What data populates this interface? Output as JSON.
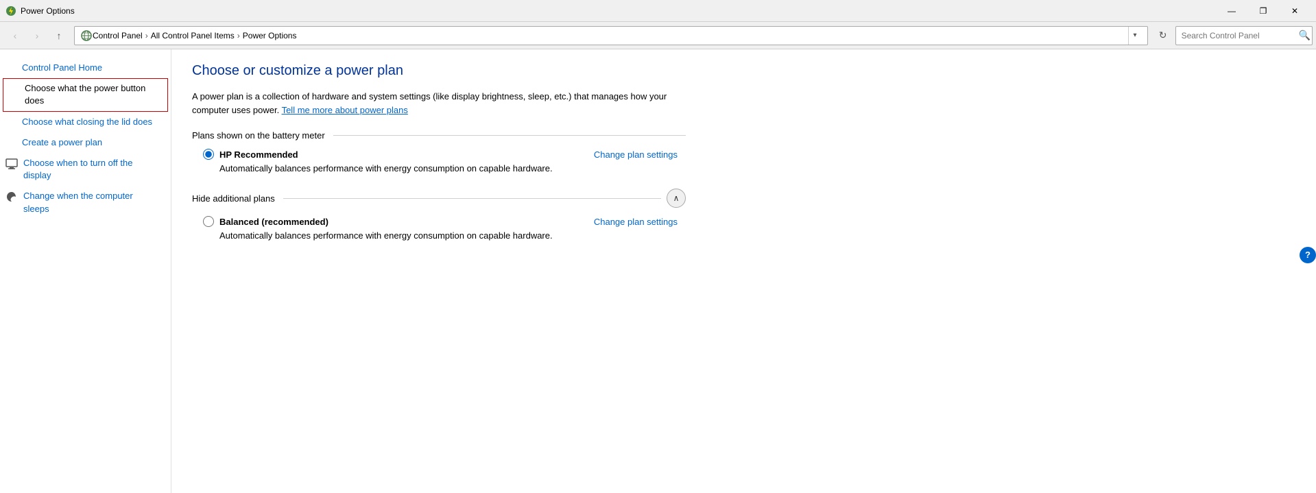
{
  "titleBar": {
    "title": "Power Options",
    "iconColor": "#4a8a4a",
    "controls": {
      "minimize": "—",
      "maximize": "❐",
      "close": "✕"
    }
  },
  "navBar": {
    "back": "‹",
    "forward": "›",
    "up": "↑",
    "refresh": "↻",
    "breadcrumb": [
      {
        "label": "Control Panel",
        "sep": "›"
      },
      {
        "label": "All Control Panel Items",
        "sep": "›"
      },
      {
        "label": "Power Options",
        "sep": ""
      }
    ],
    "searchPlaceholder": ""
  },
  "sidebar": {
    "items": [
      {
        "id": "control-panel-home",
        "label": "Control Panel Home",
        "icon": null,
        "active": false
      },
      {
        "id": "power-button",
        "label": "Choose what the power button does",
        "icon": null,
        "active": true
      },
      {
        "id": "lid",
        "label": "Choose what closing the lid does",
        "icon": null,
        "active": false
      },
      {
        "id": "create-plan",
        "label": "Create a power plan",
        "icon": null,
        "active": false
      },
      {
        "id": "turn-off-display",
        "label": "Choose when to turn off the display",
        "icon": "display",
        "active": false
      },
      {
        "id": "computer-sleeps",
        "label": "Change when the computer sleeps",
        "icon": "sleep",
        "active": false
      }
    ]
  },
  "content": {
    "pageTitle": "Choose or customize a power plan",
    "description1": "A power plan is a collection of hardware and system settings (like display brightness, sleep, etc.) that manages how your computer uses power.",
    "learnMoreText": "Tell me more about power plans",
    "sections": {
      "batteryMeter": {
        "label": "Plans shown on the battery meter",
        "plans": [
          {
            "id": "hp-recommended",
            "name": "HP Recommended",
            "selected": true,
            "changeLinkText": "Change plan settings",
            "description": "Automatically balances performance with energy consumption on capable hardware."
          }
        ]
      },
      "additionalPlans": {
        "label": "Hide additional plans",
        "collapsed": false,
        "collapseIcon": "∧",
        "plans": [
          {
            "id": "balanced",
            "name": "Balanced (recommended)",
            "selected": false,
            "changeLinkText": "Change plan settings",
            "description": "Automatically balances performance with energy consumption on capable hardware."
          }
        ]
      }
    }
  },
  "help": {
    "label": "?"
  }
}
